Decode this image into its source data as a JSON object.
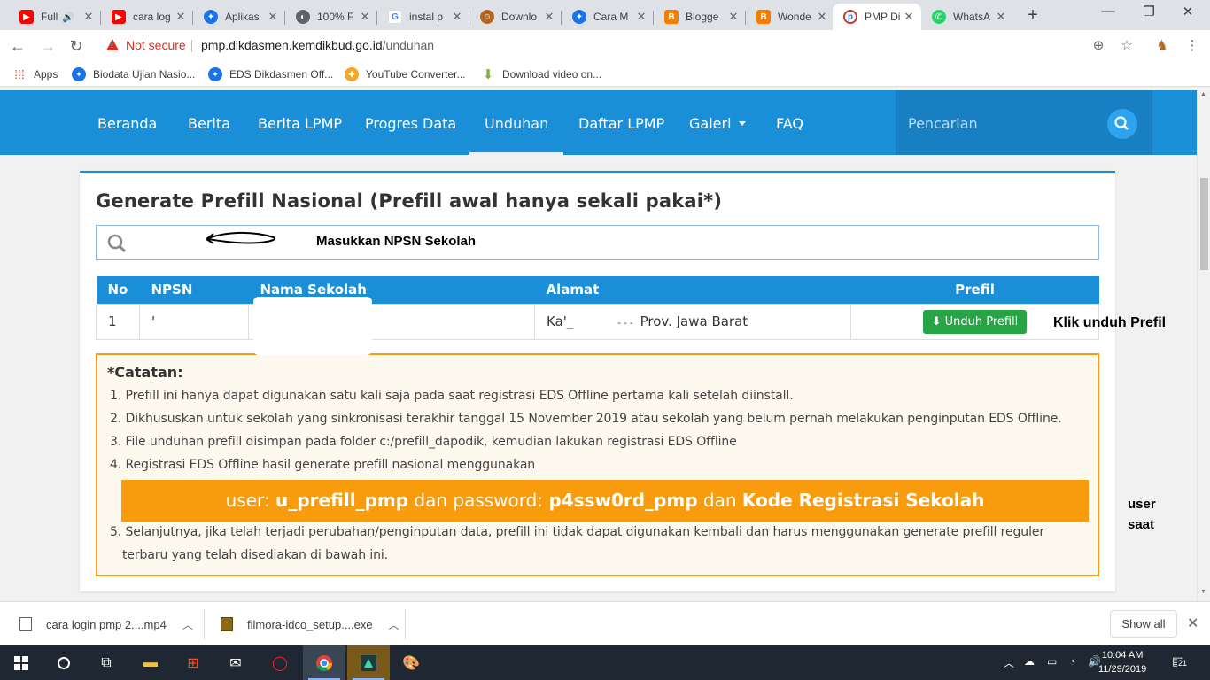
{
  "browser": {
    "tabs": [
      {
        "title": "Full",
        "icon": "youtube-icon",
        "color": "#ff0000"
      },
      {
        "title": "cara log",
        "icon": "youtube-icon",
        "color": "#ff0000"
      },
      {
        "title": "Aplikas",
        "icon": "kemdikbud-icon",
        "color": "#1a73e8"
      },
      {
        "title": "100% F",
        "icon": "globe-icon",
        "color": "#5f6368"
      },
      {
        "title": "instal p",
        "icon": "google-icon",
        "color": "#4285f4"
      },
      {
        "title": "Downlo",
        "icon": "avatar-icon",
        "color": "#b5651d"
      },
      {
        "title": "Cara M",
        "icon": "kemdikbud-icon",
        "color": "#1a73e8"
      },
      {
        "title": "Blogge",
        "icon": "blogger-icon",
        "color": "#f57d00"
      },
      {
        "title": "Wonde",
        "icon": "blogger-icon",
        "color": "#f57d00"
      },
      {
        "title": "PMP Di",
        "icon": "pmp-icon",
        "color": "#c0392b"
      },
      {
        "title": "WhatsA",
        "icon": "whatsapp-icon",
        "color": "#25d366"
      }
    ],
    "address": {
      "security": "Not secure",
      "host": "pmp.dikdasmen.kemdikbud.go.id",
      "path": "/unduhan"
    },
    "bookmarks": [
      {
        "label": "Apps"
      },
      {
        "label": "Biodata Ujian Nasio..."
      },
      {
        "label": "EDS Dikdasmen Off..."
      },
      {
        "label": "YouTube Converter..."
      },
      {
        "label": "Download video on..."
      }
    ]
  },
  "nav": {
    "items": [
      "Beranda",
      "Berita",
      "Berita LPMP",
      "Progres Data",
      "Unduhan",
      "Daftar LPMP",
      "Galeri",
      "FAQ"
    ],
    "active": "Unduhan",
    "search_placeholder": "Pencarian"
  },
  "main": {
    "title": "Generate Prefill Nasional (Prefill awal hanya sekali pakai*)",
    "npsn_annotation": "Masukkan NPSN Sekolah",
    "table": {
      "columns": [
        "No",
        "NPSN",
        "Nama Sekolah",
        "Alamat",
        "Prefil"
      ],
      "rows": [
        {
          "no": "1",
          "npsn": "'",
          "nama": "",
          "alamat_prefix": "Ka'_",
          "alamat_mid": "- - -",
          "alamat_suffix": "Prov. Jawa Barat",
          "button": "Unduh Prefill"
        }
      ]
    },
    "unduh_annotation": "Klik unduh Prefil",
    "notes": {
      "title": "*Catatan:",
      "items": [
        "1. Prefill ini hanya dapat digunakan satu kali saja pada saat registrasi EDS Offline pertama kali setelah diinstall.",
        "2. Dikhususkan untuk sekolah yang sinkronisasi terakhir tanggal 15 November 2019 atau sekolah yang belum pernah melakukan penginputan EDS Offline.",
        "3. File unduhan prefill disimpan pada folder c:/prefill_dapodik, kemudian lakukan registrasi EDS Offline",
        "4. Registrasi EDS Offline hasil generate prefill nasional menggunakan",
        "5. Selanjutnya, jika telah terjadi perubahan/penginputan data, prefill ini tidak dapat digunakan kembali dan harus menggunakan generate prefill reguler",
        "terbaru yang telah disediakan di bawah ini."
      ],
      "banner": {
        "p1": "user: ",
        "b1": "u_prefill_pmp",
        "p2": " dan password: ",
        "b2": "p4ssw0rd_pmp",
        "p3": " dan ",
        "b3": "Kode Registrasi Sekolah"
      }
    },
    "side_annotation_1": "user",
    "side_annotation_2": "saat"
  },
  "downloads": {
    "items": [
      "cara login pmp 2....mp4",
      "filmora-idco_setup....exe"
    ],
    "show_all": "Show all"
  },
  "taskbar": {
    "time": "10:04 AM",
    "date": "11/29/2019",
    "notifications": "21"
  },
  "colors": {
    "nav_blue": "#1a8fd8",
    "accent_orange": "#f89c0e",
    "button_green": "#27a444",
    "warning_red": "#d93025"
  }
}
